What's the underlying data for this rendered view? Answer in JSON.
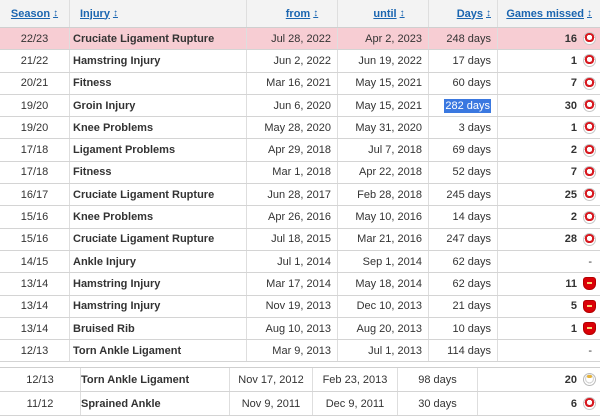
{
  "header": {
    "season": "Season",
    "injury": "Injury",
    "from": "from",
    "until": "until",
    "days": "Days",
    "games": "Games missed",
    "sort_icon": "↕"
  },
  "rows": [
    {
      "season": "22/23",
      "injury": "Cruciate Ligament Rupture",
      "from": "Jul 28, 2022",
      "until": "Apr 2, 2023",
      "days": "248 days",
      "games": "16",
      "club": "southampton-crest-icon"
    },
    {
      "season": "21/22",
      "injury": "Hamstring Injury",
      "from": "Jun 2, 2022",
      "until": "Jun 19, 2022",
      "days": "17 days",
      "games": "1",
      "club": "southampton-crest-icon"
    },
    {
      "season": "20/21",
      "injury": "Fitness",
      "from": "Mar 16, 2021",
      "until": "May 15, 2021",
      "days": "60 days",
      "games": "7",
      "club": "southampton-crest-icon"
    },
    {
      "season": "19/20",
      "injury": "Groin Injury",
      "from": "Jun 6, 2020",
      "until": "May 15, 2021",
      "days": "282 days",
      "games": "30",
      "club": "southampton-crest-icon"
    },
    {
      "season": "19/20",
      "injury": "Knee Problems",
      "from": "May 28, 2020",
      "until": "May 31, 2020",
      "days": "3 days",
      "games": "1",
      "club": "southampton-crest-icon"
    },
    {
      "season": "17/18",
      "injury": "Ligament Problems",
      "from": "Apr 29, 2018",
      "until": "Jul 7, 2018",
      "days": "69 days",
      "games": "2",
      "club": "southampton-crest-icon"
    },
    {
      "season": "17/18",
      "injury": "Fitness",
      "from": "Mar 1, 2018",
      "until": "Apr 22, 2018",
      "days": "52 days",
      "games": "7",
      "club": "southampton-crest-icon"
    },
    {
      "season": "16/17",
      "injury": "Cruciate Ligament Rupture",
      "from": "Jun 28, 2017",
      "until": "Feb 28, 2018",
      "days": "245 days",
      "games": "25",
      "club": "southampton-crest-icon"
    },
    {
      "season": "15/16",
      "injury": "Knee Problems",
      "from": "Apr 26, 2016",
      "until": "May 10, 2016",
      "days": "14 days",
      "games": "2",
      "club": "southampton-crest-icon"
    },
    {
      "season": "15/16",
      "injury": "Cruciate Ligament Rupture",
      "from": "Jul 18, 2015",
      "until": "Mar 21, 2016",
      "days": "247 days",
      "games": "28",
      "club": "southampton-crest-icon"
    },
    {
      "season": "14/15",
      "injury": "Ankle Injury",
      "from": "Jul 1, 2014",
      "until": "Sep 1, 2014",
      "days": "62 days",
      "games": "-",
      "club": ""
    },
    {
      "season": "13/14",
      "injury": "Hamstring Injury",
      "from": "Mar 17, 2014",
      "until": "May 18, 2014",
      "days": "62 days",
      "games": "11",
      "club": "arsenal-crest-icon"
    },
    {
      "season": "13/14",
      "injury": "Hamstring Injury",
      "from": "Nov 19, 2013",
      "until": "Dec 10, 2013",
      "days": "21 days",
      "games": "5",
      "club": "arsenal-crest-icon"
    },
    {
      "season": "13/14",
      "injury": "Bruised Rib",
      "from": "Aug 10, 2013",
      "until": "Aug 20, 2013",
      "days": "10 days",
      "games": "1",
      "club": "arsenal-crest-icon"
    },
    {
      "season": "12/13",
      "injury": "Torn Ankle Ligament",
      "from": "Mar 9, 2013",
      "until": "Jul 1, 2013",
      "days": "114 days",
      "games": "-",
      "club": ""
    }
  ],
  "rows2": [
    {
      "season": "12/13",
      "injury": "Torn Ankle Ligament",
      "from": "Nov 17, 2012",
      "until": "Feb 23, 2013",
      "days": "98 days",
      "games": "20",
      "club": "realmadrid-crest-icon"
    },
    {
      "season": "11/12",
      "injury": "Sprained Ankle",
      "from": "Nov 9, 2011",
      "until": "Dec 9, 2011",
      "days": "30 days",
      "games": "6",
      "club": "southampton-crest-icon"
    }
  ],
  "selected_row_index": 3,
  "highlight_row_index": 0
}
